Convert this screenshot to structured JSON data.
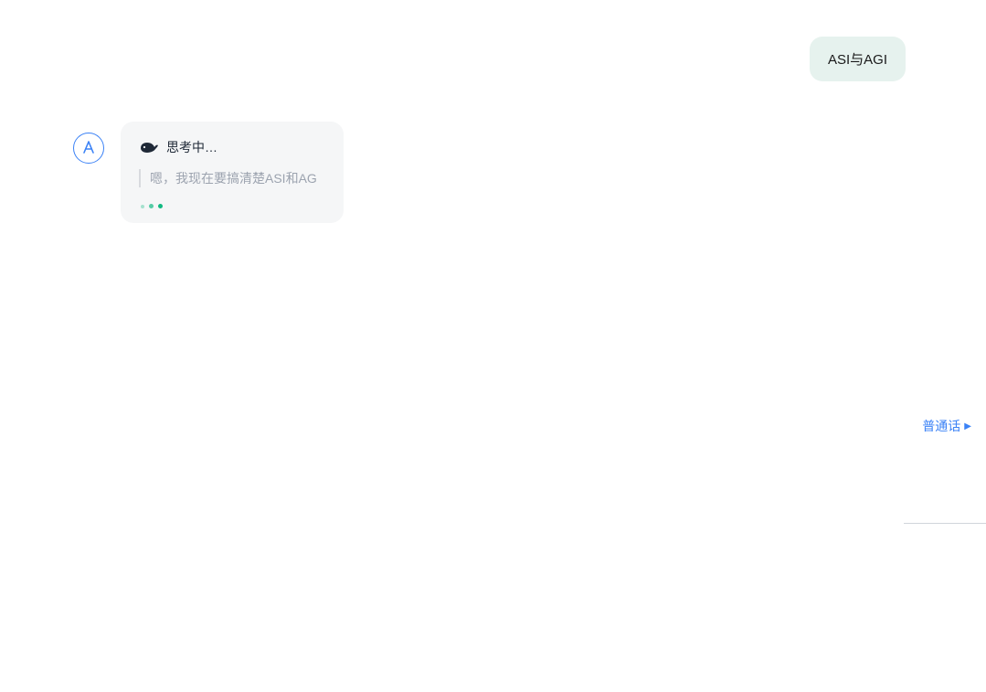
{
  "user_message": {
    "text": "ASI与AGI"
  },
  "assistant": {
    "avatar_label": "AI",
    "thinking_label": "思考中…",
    "thinking_preview": "嗯，我现在要搞清楚ASI和AG"
  },
  "lang_switch": {
    "label": "普通话"
  }
}
